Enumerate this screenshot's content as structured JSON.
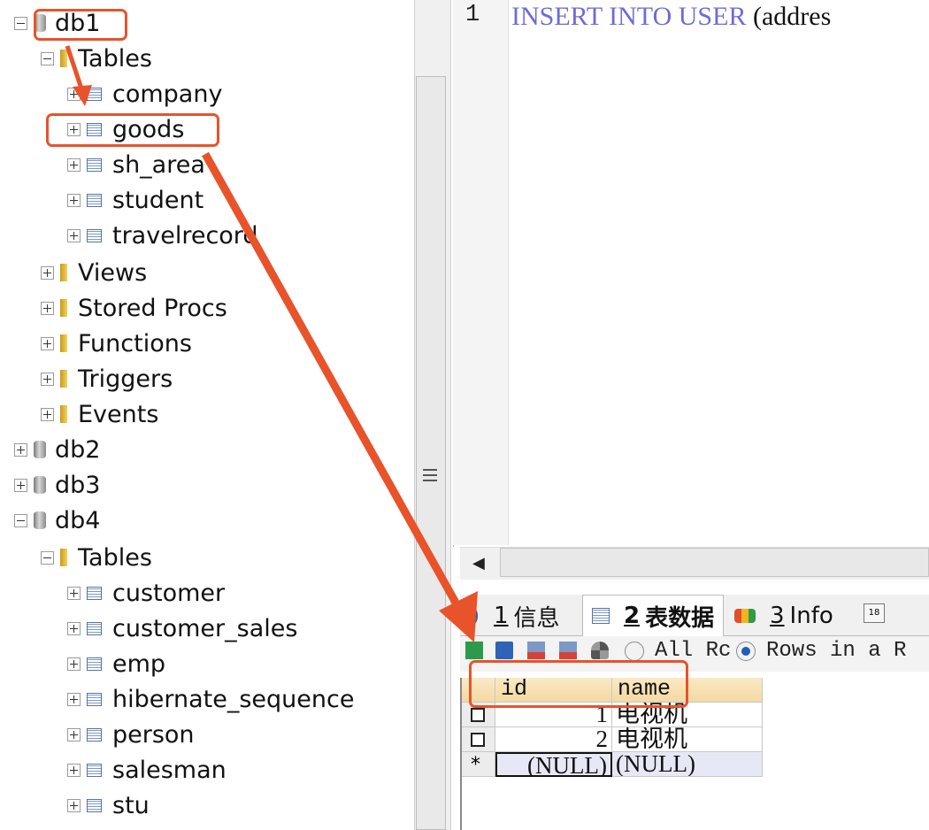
{
  "tree": {
    "nodes": [
      {
        "label": "db1",
        "type": "db",
        "expanded": true,
        "depth": 0
      },
      {
        "label": "Tables",
        "type": "folder",
        "expanded": true,
        "depth": 1
      },
      {
        "label": "company",
        "type": "table",
        "expanded": false,
        "depth": 2
      },
      {
        "label": "goods",
        "type": "table",
        "expanded": false,
        "depth": 2
      },
      {
        "label": "sh_area",
        "type": "table",
        "expanded": false,
        "depth": 2
      },
      {
        "label": "student",
        "type": "table",
        "expanded": false,
        "depth": 2
      },
      {
        "label": "travelrecord",
        "type": "table",
        "expanded": false,
        "depth": 2
      },
      {
        "label": "Views",
        "type": "folder",
        "expanded": false,
        "depth": 1
      },
      {
        "label": "Stored Procs",
        "type": "folder",
        "expanded": false,
        "depth": 1
      },
      {
        "label": "Functions",
        "type": "folder",
        "expanded": false,
        "depth": 1
      },
      {
        "label": "Triggers",
        "type": "folder",
        "expanded": false,
        "depth": 1
      },
      {
        "label": "Events",
        "type": "folder",
        "expanded": false,
        "depth": 1
      },
      {
        "label": "db2",
        "type": "db",
        "expanded": false,
        "depth": 0
      },
      {
        "label": "db3",
        "type": "db",
        "expanded": false,
        "depth": 0
      },
      {
        "label": "db4",
        "type": "db",
        "expanded": true,
        "depth": 0
      },
      {
        "label": "Tables",
        "type": "folder",
        "expanded": true,
        "depth": 1
      },
      {
        "label": "customer",
        "type": "table",
        "expanded": false,
        "depth": 2
      },
      {
        "label": "customer_sales",
        "type": "table",
        "expanded": false,
        "depth": 2
      },
      {
        "label": "emp",
        "type": "table",
        "expanded": false,
        "depth": 2
      },
      {
        "label": "hibernate_sequence",
        "type": "table",
        "expanded": false,
        "depth": 2
      },
      {
        "label": "person",
        "type": "table",
        "expanded": false,
        "depth": 2
      },
      {
        "label": "salesman",
        "type": "table",
        "expanded": false,
        "depth": 2
      },
      {
        "label": "stu",
        "type": "table",
        "expanded": false,
        "depth": 2
      }
    ]
  },
  "editor": {
    "line_number": "1",
    "kw1": "INSERT",
    "kw2": "INTO",
    "kw3": "USER",
    "rest": "(addres"
  },
  "tabs": [
    {
      "num": "1",
      "label": "信息"
    },
    {
      "num": "2",
      "label": "表数据"
    },
    {
      "num": "3",
      "label": "Info"
    }
  ],
  "toolbar": {
    "radio_all": "All Rc",
    "radio_rows": "Rows in a R"
  },
  "grid": {
    "columns": [
      "id",
      "name"
    ],
    "rows": [
      {
        "marker": "",
        "id": "1",
        "name": "电视机"
      },
      {
        "marker": "",
        "id": "2",
        "name": "电视机"
      },
      {
        "marker": "*",
        "id": "(NULL)",
        "name": "(NULL)"
      }
    ]
  },
  "colors": {
    "annotation": "#e8532a",
    "keyword": "#6c6cd8",
    "header": "#f3d9a3"
  }
}
